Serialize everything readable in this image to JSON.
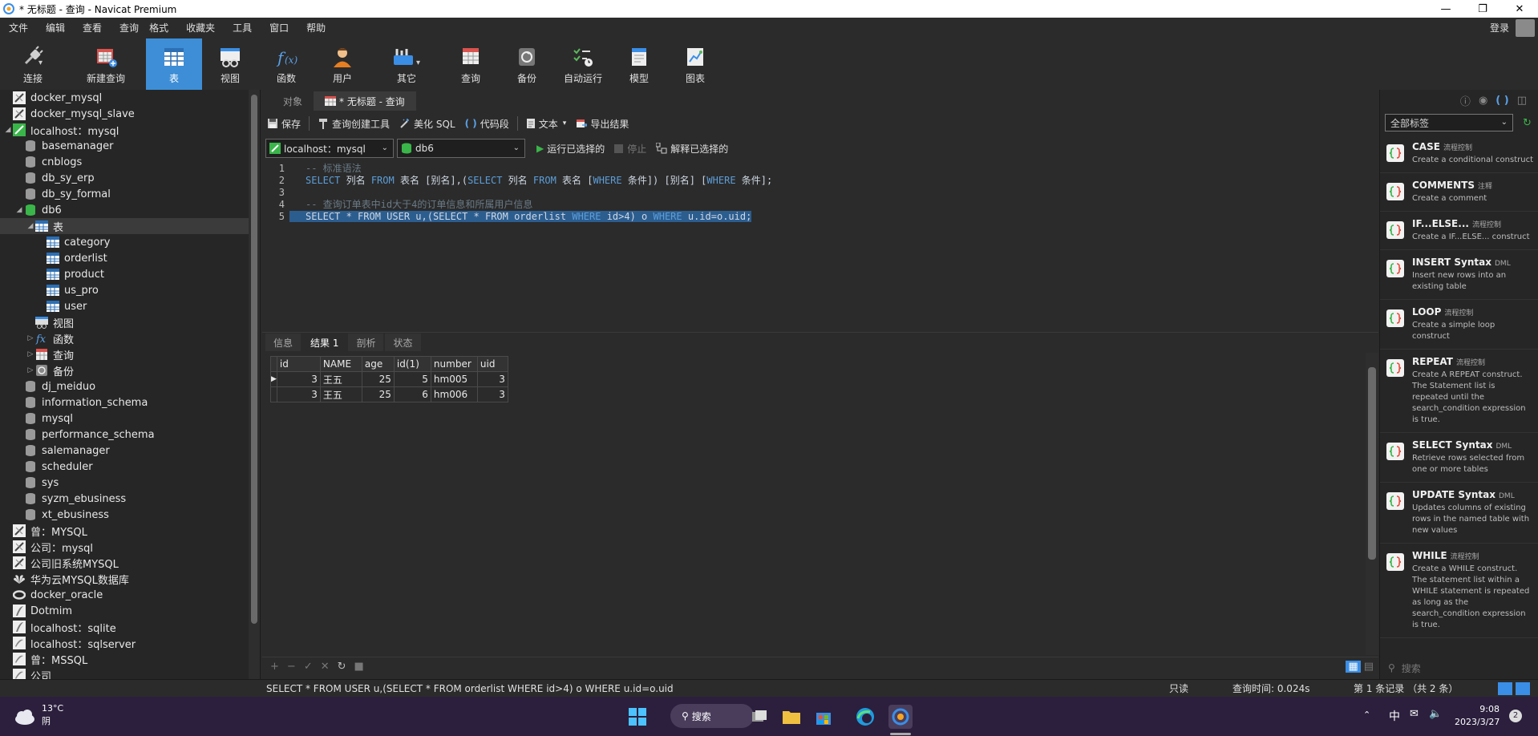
{
  "window": {
    "title": "* 无标题 - 查询 - Navicat Premium"
  },
  "menu": [
    "文件",
    "编辑",
    "查看",
    "查询",
    "格式",
    "收藏夹",
    "工具",
    "窗口",
    "帮助"
  ],
  "login_label": "登录",
  "toolbar": [
    {
      "label": "连接",
      "icon": "plug-icon"
    },
    {
      "label": "新建查询",
      "icon": "new-query-icon"
    },
    {
      "label": "表",
      "icon": "table-icon"
    },
    {
      "label": "视图",
      "icon": "view-icon"
    },
    {
      "label": "函数",
      "icon": "function-icon"
    },
    {
      "label": "用户",
      "icon": "user-icon"
    },
    {
      "label": "其它",
      "icon": "tools-icon"
    },
    {
      "label": "查询",
      "icon": "query-icon"
    },
    {
      "label": "备份",
      "icon": "backup-icon"
    },
    {
      "label": "自动运行",
      "icon": "auto-run-icon"
    },
    {
      "label": "模型",
      "icon": "model-icon"
    },
    {
      "label": "图表",
      "icon": "chart-icon"
    }
  ],
  "tree": [
    {
      "label": "docker_mysql",
      "level": 0,
      "type": "conn"
    },
    {
      "label": "docker_mysql_slave",
      "level": 0,
      "type": "conn"
    },
    {
      "label": "localhost：mysql",
      "level": 0,
      "type": "conn-open",
      "expanded": true
    },
    {
      "label": "basemanager",
      "level": 1,
      "type": "db"
    },
    {
      "label": "cnblogs",
      "level": 1,
      "type": "db"
    },
    {
      "label": "db_sy_erp",
      "level": 1,
      "type": "db"
    },
    {
      "label": "db_sy_formal",
      "level": 1,
      "type": "db"
    },
    {
      "label": "db6",
      "level": 1,
      "type": "db-open",
      "expanded": true
    },
    {
      "label": "表",
      "level": 2,
      "type": "tables",
      "expanded": true,
      "selected": true
    },
    {
      "label": "category",
      "level": 3,
      "type": "table"
    },
    {
      "label": "orderlist",
      "level": 3,
      "type": "table"
    },
    {
      "label": "product",
      "level": 3,
      "type": "table"
    },
    {
      "label": "us_pro",
      "level": 3,
      "type": "table"
    },
    {
      "label": "user",
      "level": 3,
      "type": "table"
    },
    {
      "label": "视图",
      "level": 2,
      "type": "views"
    },
    {
      "label": "函数",
      "level": 2,
      "type": "functions",
      "collapsed": true
    },
    {
      "label": "查询",
      "level": 2,
      "type": "queries",
      "collapsed": true
    },
    {
      "label": "备份",
      "level": 2,
      "type": "backups",
      "collapsed": true
    },
    {
      "label": "dj_meiduo",
      "level": 1,
      "type": "db"
    },
    {
      "label": "information_schema",
      "level": 1,
      "type": "db"
    },
    {
      "label": "mysql",
      "level": 1,
      "type": "db"
    },
    {
      "label": "performance_schema",
      "level": 1,
      "type": "db"
    },
    {
      "label": "salemanager",
      "level": 1,
      "type": "db"
    },
    {
      "label": "scheduler",
      "level": 1,
      "type": "db"
    },
    {
      "label": "sys",
      "level": 1,
      "type": "db"
    },
    {
      "label": "syzm_ebusiness",
      "level": 1,
      "type": "db"
    },
    {
      "label": "xt_ebusiness",
      "level": 1,
      "type": "db"
    },
    {
      "label": "曾：MYSQL",
      "level": 0,
      "type": "conn"
    },
    {
      "label": "公司：mysql",
      "level": 0,
      "type": "conn"
    },
    {
      "label": "公司旧系统MYSQL",
      "level": 0,
      "type": "conn"
    },
    {
      "label": "华为云MYSQL数据库",
      "level": 0,
      "type": "conn-huawei"
    },
    {
      "label": "docker_oracle",
      "level": 0,
      "type": "conn-oracle"
    },
    {
      "label": "Dotmim",
      "level": 0,
      "type": "conn-sqlite"
    },
    {
      "label": "localhost：sqlite",
      "level": 0,
      "type": "conn-sqlite"
    },
    {
      "label": "localhost：sqlserver",
      "level": 0,
      "type": "conn-sqlserver"
    },
    {
      "label": "曾：MSSQL",
      "level": 0,
      "type": "conn-sqlserver"
    },
    {
      "label": "公司",
      "level": 0,
      "type": "conn-sqlserver"
    }
  ],
  "tabs": [
    {
      "label": "对象"
    },
    {
      "label": "* 无标题 - 查询"
    }
  ],
  "query_toolbar": {
    "save": "保存",
    "builder": "查询创建工具",
    "beautify": "美化 SQL",
    "snippet": "代码段",
    "text": "文本",
    "export": "导出结果"
  },
  "conn_bar": {
    "connection": "localhost：mysql",
    "database": "db6",
    "run": "运行已选择的",
    "stop": "停止",
    "explain": "解释已选择的"
  },
  "editor": {
    "lines": [
      {
        "num": "1",
        "segs": [
          {
            "t": "-- 标准语法",
            "c": "cm"
          }
        ]
      },
      {
        "num": "2",
        "segs": [
          {
            "t": "SELECT",
            "c": "kw"
          },
          {
            "t": " 列名 ",
            "c": ""
          },
          {
            "t": "FROM",
            "c": "kw"
          },
          {
            "t": " 表名 [别名],(",
            "c": ""
          },
          {
            "t": "SELECT",
            "c": "kw"
          },
          {
            "t": " 列名 ",
            "c": ""
          },
          {
            "t": "FROM",
            "c": "kw"
          },
          {
            "t": " 表名 [",
            "c": ""
          },
          {
            "t": "WHERE",
            "c": "kw"
          },
          {
            "t": " 条件]) [别名] [",
            "c": ""
          },
          {
            "t": "WHERE",
            "c": "kw"
          },
          {
            "t": " 条件];",
            "c": ""
          }
        ]
      },
      {
        "num": "3",
        "segs": []
      },
      {
        "num": "4",
        "segs": [
          {
            "t": "-- 查询订单表中id大于4的订单信息和所属用户信息",
            "c": "cm"
          }
        ]
      },
      {
        "num": "5",
        "hl": true,
        "segs": [
          {
            "t": "SELECT * FROM USER u,(SELECT * FROM orderlist ",
            "c": ""
          },
          {
            "t": "WHERE",
            "c": "kw"
          },
          {
            "t": " id>4) o ",
            "c": ""
          },
          {
            "t": "WHERE",
            "c": "kw"
          },
          {
            "t": " u.id=o.uid;",
            "c": ""
          }
        ]
      }
    ]
  },
  "result_tabs": [
    {
      "label": "信息"
    },
    {
      "label": "结果 1"
    },
    {
      "label": "剖析"
    },
    {
      "label": "状态"
    }
  ],
  "result": {
    "columns": [
      "id",
      "NAME",
      "age",
      "id(1)",
      "number",
      "uid"
    ],
    "rows": [
      [
        "3",
        "王五",
        "25",
        "5",
        "hm005",
        "3"
      ],
      [
        "3",
        "王五",
        "25",
        "6",
        "hm006",
        "3"
      ]
    ]
  },
  "snippets": {
    "filter": "全部标签",
    "items": [
      {
        "title": "CASE",
        "tag": "流程控制",
        "desc": "Create a conditional construct"
      },
      {
        "title": "COMMENTS",
        "tag": "注释",
        "desc": "Create a comment"
      },
      {
        "title": "IF...ELSE...",
        "tag": "流程控制",
        "desc": "Create a IF...ELSE... construct"
      },
      {
        "title": "INSERT Syntax",
        "tag": "DML",
        "desc": "Insert new rows into an existing table"
      },
      {
        "title": "LOOP",
        "tag": "流程控制",
        "desc": "Create a simple loop construct"
      },
      {
        "title": "REPEAT",
        "tag": "流程控制",
        "desc": "Create A REPEAT construct. The Statement list is repeated until the search_condition expression is true."
      },
      {
        "title": "SELECT Syntax",
        "tag": "DML",
        "desc": "Retrieve rows selected from one or more tables"
      },
      {
        "title": "UPDATE Syntax",
        "tag": "DML",
        "desc": "Updates columns of existing rows in the named table with new values"
      },
      {
        "title": "WHILE",
        "tag": "流程控制",
        "desc": "Create a WHILE construct. The statement list within a WHILE statement is repeated as long as the search_condition expression is true."
      }
    ],
    "search_placeholder": "搜索"
  },
  "status": {
    "sql": "SELECT * FROM USER u,(SELECT * FROM orderlist WHERE id>4) o WHERE u.id=o.uid",
    "readonly": "只读",
    "time": "查询时间: 0.024s",
    "records": "第 1 条记录 （共 2 条）"
  },
  "taskbar": {
    "temp": "13°C",
    "weather": "阴",
    "search": "搜索",
    "ime": "中",
    "time": "9:08",
    "date": "2023/3/27",
    "notif": "2"
  }
}
